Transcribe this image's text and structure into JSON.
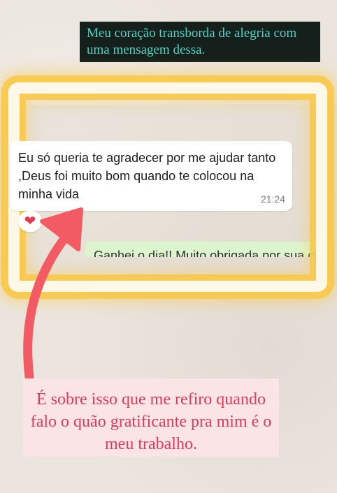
{
  "top_caption": "Meu coração transborda de alegria com uma mensagem dessa.",
  "message": {
    "text": "Eu só queria te agradecer por me ajudar tanto ,Deus foi muito bom quando te colocou na minha vida",
    "time": "21:24",
    "reaction": "❤",
    "reaction_icon": "red-heart"
  },
  "next_message_partial": "Ganhei o dia!! Muito obrigada por sua confiança",
  "bottom_caption": "É sobre isso que me refiro quando falo o quão gratificante pra mim  é o meu trabalho.",
  "colors": {
    "highlight": "#f9c846",
    "arrow": "#f25a64",
    "caption_top_bg": "#15201c",
    "caption_top_text": "#4fd3c4",
    "caption_bottom_bg": "#fae4e6",
    "caption_bottom_text": "#e03a5a"
  }
}
